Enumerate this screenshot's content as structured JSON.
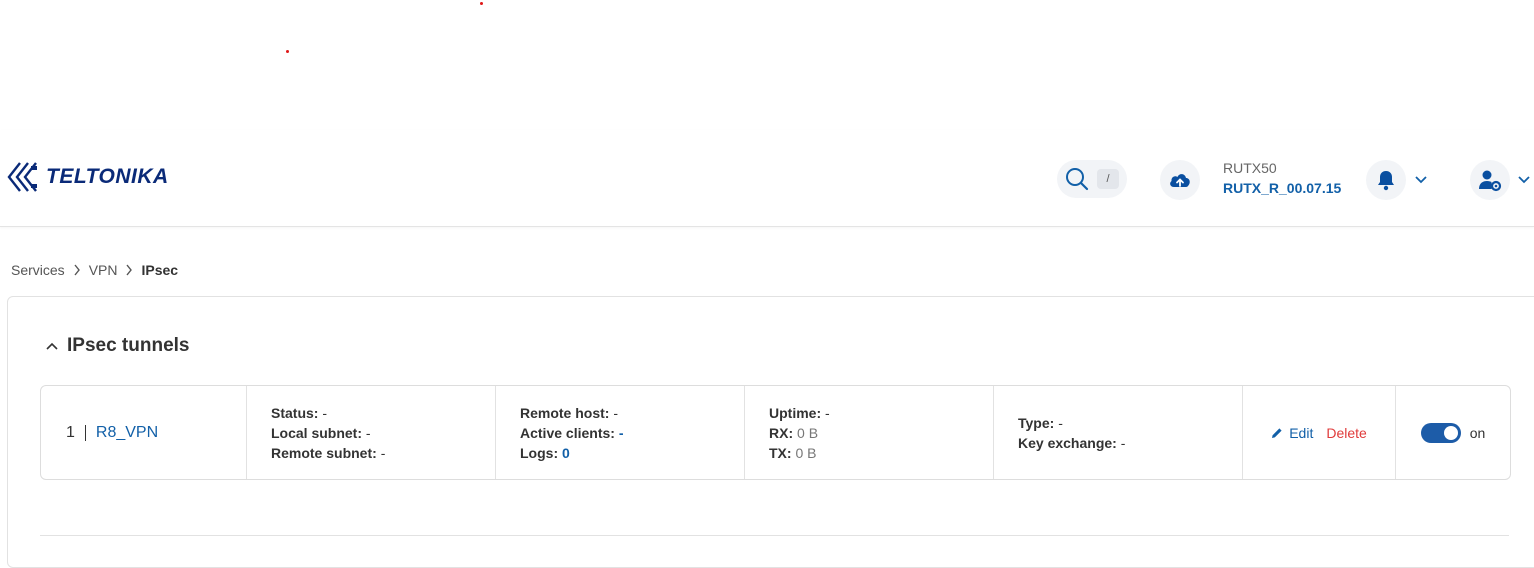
{
  "brand": {
    "name": "TELTONIKA"
  },
  "search": {
    "shortcut": "/"
  },
  "device": {
    "model": "RUTX50",
    "firmware": "RUTX_R_00.07.15"
  },
  "breadcrumb": [
    "Services",
    "VPN",
    "IPsec"
  ],
  "section": {
    "title": "IPsec tunnels"
  },
  "tunnel": {
    "index": "1",
    "name": "R8_VPN",
    "status_label": "Status:",
    "status_value": "-",
    "local_subnet_label": "Local subnet:",
    "local_subnet_value": "-",
    "remote_subnet_label": "Remote subnet:",
    "remote_subnet_value": "-",
    "remote_host_label": "Remote host:",
    "remote_host_value": "-",
    "active_clients_label": "Active clients:",
    "active_clients_value": "-",
    "logs_label": "Logs:",
    "logs_value": "0",
    "uptime_label": "Uptime:",
    "uptime_value": "-",
    "rx_label": "RX:",
    "rx_value": "0 B",
    "tx_label": "TX:",
    "tx_value": "0 B",
    "type_label": "Type:",
    "type_value": "-",
    "key_exchange_label": "Key exchange:",
    "key_exchange_value": "-",
    "edit_label": "Edit",
    "delete_label": "Delete",
    "enabled_label": "on"
  },
  "colors": {
    "brand": "#0a2a78",
    "link": "#1260a8",
    "danger": "#e03b3b",
    "toggle_on": "#1d5ca8"
  }
}
